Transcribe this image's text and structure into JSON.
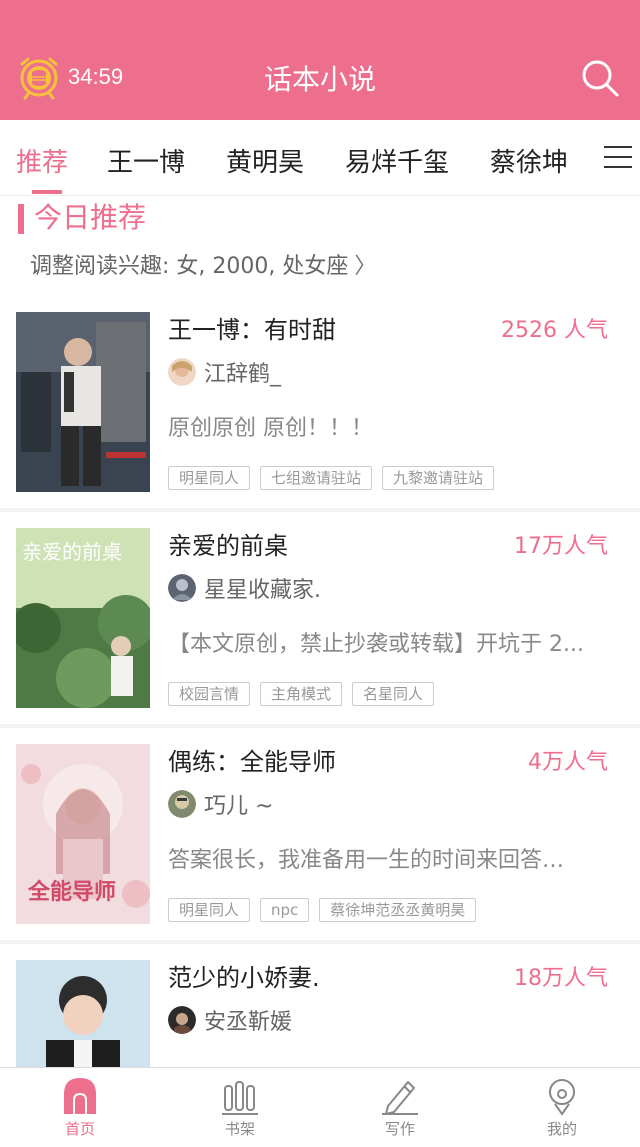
{
  "header": {
    "timer": "34:59",
    "title": "话本小说"
  },
  "tabs": [
    {
      "label": "推荐",
      "active": true
    },
    {
      "label": "王一博"
    },
    {
      "label": "黄明昊"
    },
    {
      "label": "易烊千玺"
    },
    {
      "label": "蔡徐坤"
    }
  ],
  "section": {
    "title": "今日推荐",
    "interest": "调整阅读兴趣: 女, 2000, 处女座"
  },
  "books": [
    {
      "title": "王一博：有时甜",
      "popularity": "2526 人气",
      "author": "江辞鹤_",
      "description": "原创原创 原创！！！",
      "tags": [
        "明星同人",
        "七组邀请驻站",
        "九黎邀请驻站"
      ]
    },
    {
      "title": "亲爱的前桌",
      "popularity": "17万人气",
      "author": "星星收藏家.",
      "description": "【本文原创，禁止抄袭或转载】开坑于 2...",
      "tags": [
        "校园言情",
        "主角模式",
        "名星同人"
      ],
      "cover_text": "亲爱的前桌"
    },
    {
      "title": "偶练：全能导师",
      "popularity": "4万人气",
      "author": "巧儿 ~",
      "description": "答案很长，我准备用一生的时间来回答…",
      "tags": [
        "明星同人",
        "npc",
        "蔡徐坤范丞丞黄明昊"
      ],
      "cover_text": "全能导师"
    },
    {
      "title": "范少的小娇妻.",
      "popularity": "18万人气",
      "author": "安丞靳媛",
      "description": "",
      "tags": []
    }
  ],
  "bottom_nav": [
    {
      "label": "首页",
      "icon": "home-icon",
      "active": true
    },
    {
      "label": "书架",
      "icon": "bookshelf-icon"
    },
    {
      "label": "写作",
      "icon": "pencil-icon"
    },
    {
      "label": "我的",
      "icon": "profile-icon"
    }
  ],
  "colors": {
    "accent": "#ee6e8e"
  }
}
